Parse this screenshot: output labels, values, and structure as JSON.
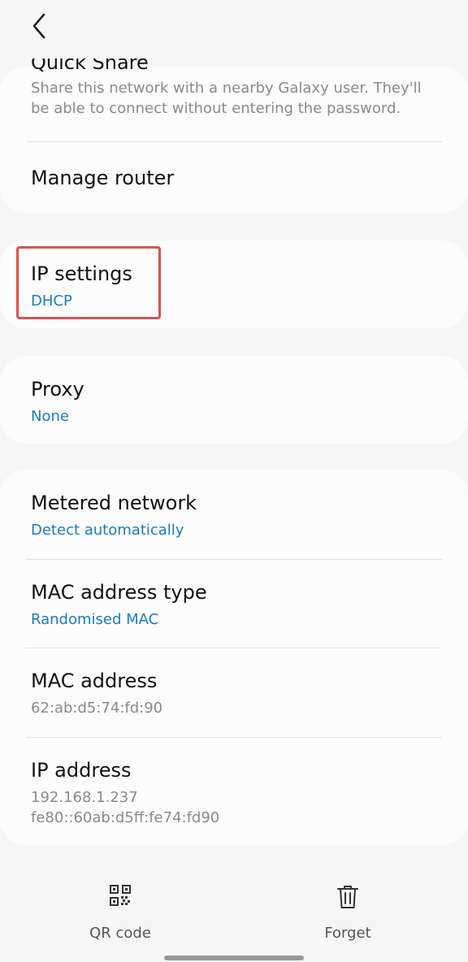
{
  "header": {
    "back_icon": "chevron-left-icon"
  },
  "sections": {
    "quick_share": {
      "title": "Quick Share",
      "description": "Share this network with a nearby Galaxy user. They'll be able to connect without entering the password."
    },
    "manage_router": {
      "title": "Manage router"
    },
    "ip_settings": {
      "title": "IP settings",
      "value": "DHCP"
    },
    "proxy": {
      "title": "Proxy",
      "value": "None"
    },
    "metered_network": {
      "title": "Metered network",
      "value": "Detect automatically"
    },
    "mac_address_type": {
      "title": "MAC address type",
      "value": "Randomised MAC"
    },
    "mac_address": {
      "title": "MAC address",
      "value": "62:ab:d5:74:fd:90"
    },
    "ip_address": {
      "title": "IP address",
      "value_ipv4": "192.168.1.237",
      "value_ipv6": "fe80::60ab:d5ff:fe74:fd90"
    }
  },
  "bottom_bar": {
    "qr_code": {
      "label": "QR code",
      "icon": "qr-code-icon"
    },
    "forget": {
      "label": "Forget",
      "icon": "trash-icon"
    }
  },
  "colors": {
    "accent": "#1a7bbf",
    "highlight": "#d9534f",
    "background": "#f6f6f6",
    "card": "#fcfcfc"
  }
}
